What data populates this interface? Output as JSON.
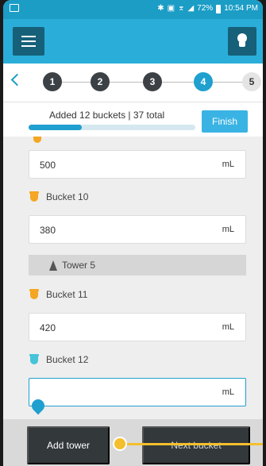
{
  "status_bar": {
    "battery": "72%",
    "time": "10:54 PM",
    "icons": [
      "bluetooth-icon",
      "vibrate-icon",
      "wifi-icon",
      "signal-icon",
      "battery-icon"
    ]
  },
  "app_bar": {
    "menu_icon": "hamburger-menu-icon",
    "tip_icon": "lightbulb-icon",
    "color": "#2aaed9"
  },
  "stepper": {
    "back_icon": "chevron-left-icon",
    "steps": [
      "1",
      "2",
      "3",
      "4",
      "5"
    ],
    "active_step": 4
  },
  "progress": {
    "text": "Added 12 buckets | 37 total",
    "fraction": 0.32,
    "finish_label": "Finish"
  },
  "form": {
    "items": [
      {
        "type": "field",
        "value": "500",
        "unit": "mL"
      },
      {
        "type": "bucket",
        "label": "Bucket 10",
        "color": "#f5a623"
      },
      {
        "type": "field",
        "value": "380",
        "unit": "mL"
      },
      {
        "type": "tower",
        "label": "Tower 5"
      },
      {
        "type": "bucket",
        "label": "Bucket 11",
        "color": "#f5a623"
      },
      {
        "type": "field",
        "value": "420",
        "unit": "mL"
      },
      {
        "type": "bucket",
        "label": "Bucket 12",
        "color": "#45c4d8"
      },
      {
        "type": "field",
        "value": "",
        "unit": "mL"
      }
    ]
  },
  "bottom": {
    "add_tower_label": "Add tower",
    "next_bucket_label": "Next bucket"
  },
  "accent_colors": {
    "primary": "#1fa0cf",
    "dark_button": "#33383b",
    "highlight": "#f4bf2e"
  }
}
